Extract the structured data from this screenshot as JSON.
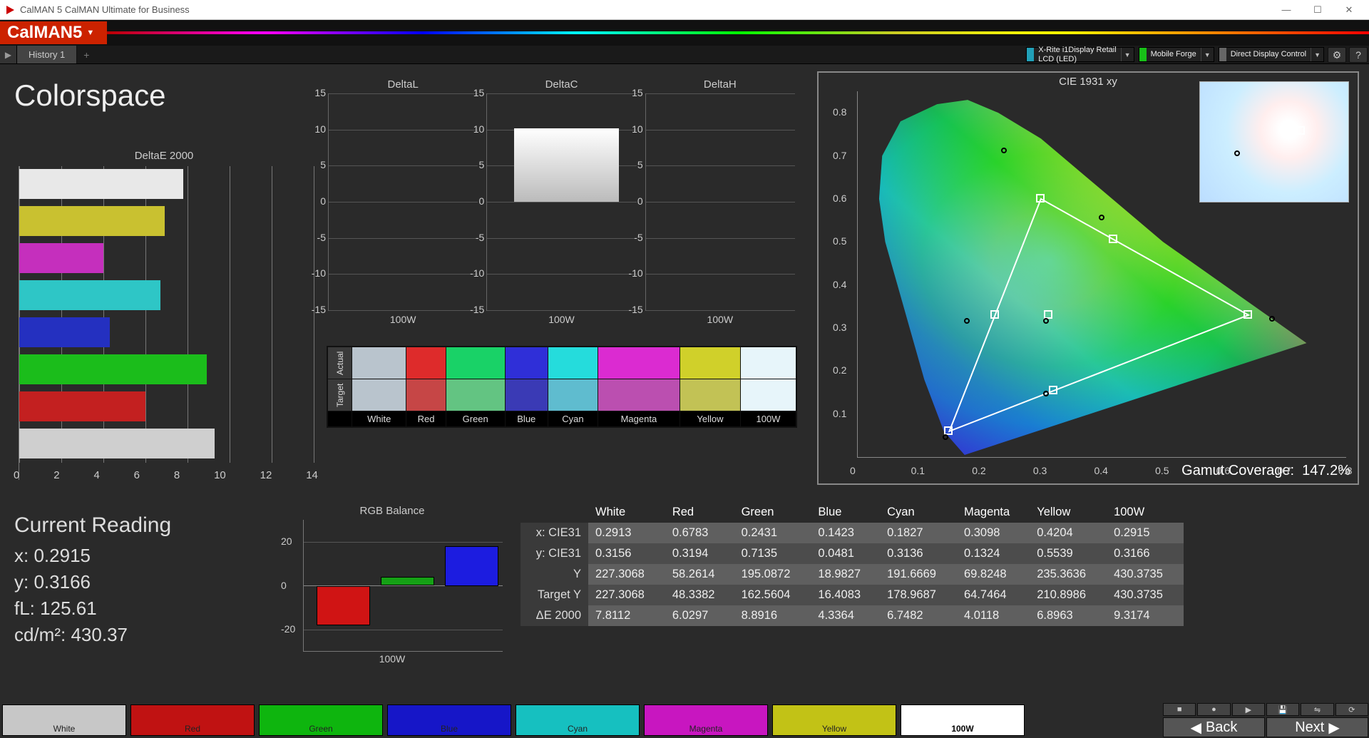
{
  "window": {
    "title": "CalMAN 5 CalMAN Ultimate for Business"
  },
  "brand": {
    "name": "CalMAN5"
  },
  "tabs": {
    "history": "History 1"
  },
  "status": [
    {
      "label": "X-Rite i1Display Retail\nLCD (LED)",
      "color": "#21a0b8"
    },
    {
      "label": "Mobile Forge",
      "color": "#18c018"
    },
    {
      "label": "Direct Display Control",
      "color": "#666"
    }
  ],
  "page": {
    "title": "Colorspace"
  },
  "chart_data": {
    "deltae": {
      "title": "DeltaE 2000",
      "type": "bar",
      "orientation": "horizontal",
      "xlim": [
        0,
        14
      ],
      "xticks": [
        0,
        2,
        4,
        6,
        8,
        10,
        12,
        14
      ],
      "series": [
        {
          "name": "White",
          "color": "#e8e8e8",
          "value": 7.8
        },
        {
          "name": "Yellow",
          "color": "#c9c130",
          "value": 6.9
        },
        {
          "name": "Magenta",
          "color": "#c52fbd",
          "value": 4.0
        },
        {
          "name": "Cyan",
          "color": "#2ec6c6",
          "value": 6.7
        },
        {
          "name": "Blue",
          "color": "#2430c0",
          "value": 4.3
        },
        {
          "name": "Green",
          "color": "#1bbd1b",
          "value": 8.9
        },
        {
          "name": "Red",
          "color": "#c32020",
          "value": 6.0
        },
        {
          "name": "100W",
          "color": "#cfcfcf",
          "value": 9.3
        }
      ]
    },
    "mini": [
      {
        "title": "DeltaL",
        "ylim": [
          -15,
          15
        ],
        "yticks": [
          15,
          10,
          5,
          0,
          -5,
          -10,
          -15
        ],
        "xlabel": "100W",
        "image": null
      },
      {
        "title": "DeltaC",
        "ylim": [
          -15,
          15
        ],
        "yticks": [
          15,
          10,
          5,
          0,
          -5,
          -10,
          -15
        ],
        "xlabel": "100W",
        "image": "whiteblock"
      },
      {
        "title": "DeltaH",
        "ylim": [
          -15,
          15
        ],
        "yticks": [
          15,
          10,
          5,
          0,
          -5,
          -10,
          -15
        ],
        "xlabel": "100W",
        "image": null
      }
    ],
    "swatches": {
      "rows": [
        "Actual",
        "Target"
      ],
      "cols": [
        "White",
        "Red",
        "Green",
        "Blue",
        "Cyan",
        "Magenta",
        "Yellow",
        "100W"
      ],
      "actual": [
        "#b9c4cd",
        "#de2b2b",
        "#19d267",
        "#2f2fd8",
        "#25dcdc",
        "#db2bd1",
        "#d0d02a",
        "#e7f5fa"
      ],
      "target": [
        "#b9c4cd",
        "#c64646",
        "#63c482",
        "#3a3ab5",
        "#5fbccf",
        "#bb4fb0",
        "#c2c255",
        "#e7f5fa"
      ]
    },
    "rgb_balance": {
      "title": "RGB Balance",
      "xlabel": "100W",
      "ylim": [
        -30,
        30
      ],
      "yticks": [
        20,
        0,
        -20
      ],
      "bars": [
        {
          "name": "R",
          "color": "#d01414",
          "value": -18
        },
        {
          "name": "G",
          "color": "#15a015",
          "value": 4
        },
        {
          "name": "B",
          "color": "#1c1ce0",
          "value": 18
        }
      ]
    },
    "cie": {
      "title": "CIE 1931 xy",
      "xlim": [
        0,
        0.8
      ],
      "ylim": [
        0,
        0.85
      ],
      "xticks": [
        0,
        0.1,
        0.2,
        0.3,
        0.4,
        0.5,
        0.6,
        0.7,
        0.8
      ],
      "yticks": [
        0.1,
        0.2,
        0.3,
        0.4,
        0.5,
        0.6,
        0.7,
        0.8
      ],
      "gamut_coverage_label": "Gamut Coverage:",
      "gamut_coverage": "147.2%",
      "target_triangle": [
        [
          0.64,
          0.33
        ],
        [
          0.3,
          0.6
        ],
        [
          0.15,
          0.06
        ]
      ],
      "target_secondaries": [
        [
          0.3127,
          0.329
        ],
        [
          0.225,
          0.329
        ],
        [
          0.321,
          0.154
        ],
        [
          0.419,
          0.505
        ]
      ],
      "measured_dots": [
        [
          0.68,
          0.32
        ],
        [
          0.24,
          0.71
        ],
        [
          0.145,
          0.045
        ],
        [
          0.18,
          0.315
        ],
        [
          0.31,
          0.315
        ],
        [
          0.4,
          0.555
        ],
        [
          0.31,
          0.145
        ]
      ]
    }
  },
  "current_reading": {
    "title": "Current Reading",
    "rows": [
      {
        "label": "x:",
        "value": "0.2915"
      },
      {
        "label": "y:",
        "value": "0.3166"
      },
      {
        "label": "fL:",
        "value": "125.61"
      },
      {
        "label": "cd/m²:",
        "value": "430.37"
      }
    ]
  },
  "datatable": {
    "columns": [
      "White",
      "Red",
      "Green",
      "Blue",
      "Cyan",
      "Magenta",
      "Yellow",
      "100W"
    ],
    "rows": [
      {
        "label": "x: CIE31",
        "cells": [
          "0.2913",
          "0.6783",
          "0.2431",
          "0.1423",
          "0.1827",
          "0.3098",
          "0.4204",
          "0.2915"
        ]
      },
      {
        "label": "y: CIE31",
        "cells": [
          "0.3156",
          "0.3194",
          "0.7135",
          "0.0481",
          "0.3136",
          "0.1324",
          "0.5539",
          "0.3166"
        ]
      },
      {
        "label": "Y",
        "cells": [
          "227.3068",
          "58.2614",
          "195.0872",
          "18.9827",
          "191.6669",
          "69.8248",
          "235.3636",
          "430.3735"
        ]
      },
      {
        "label": "Target Y",
        "cells": [
          "227.3068",
          "48.3382",
          "162.5604",
          "16.4083",
          "178.9687",
          "64.7464",
          "210.8986",
          "430.3735"
        ]
      },
      {
        "label": "ΔE 2000",
        "cells": [
          "7.8112",
          "6.0297",
          "8.8916",
          "4.3364",
          "6.7482",
          "4.0118",
          "6.8963",
          "9.3174"
        ]
      }
    ]
  },
  "bottom_swatches": [
    {
      "label": "White",
      "color": "#c7c7c7"
    },
    {
      "label": "Red",
      "color": "#c01212"
    },
    {
      "label": "Green",
      "color": "#0eb50e"
    },
    {
      "label": "Blue",
      "color": "#1616c8"
    },
    {
      "label": "Cyan",
      "color": "#16c0c0"
    },
    {
      "label": "Magenta",
      "color": "#c816c0"
    },
    {
      "label": "Yellow",
      "color": "#c2c216"
    },
    {
      "label": "100W",
      "color": "#ffffff"
    }
  ],
  "nav": {
    "back": "Back",
    "next": "Next"
  }
}
